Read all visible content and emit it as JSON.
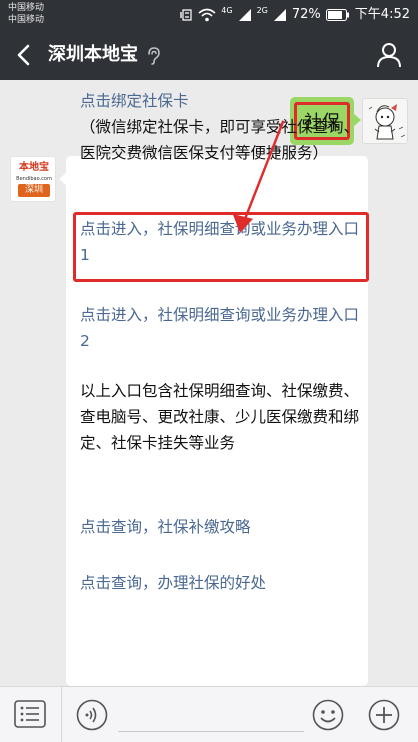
{
  "status_bar": {
    "carrier_1": "中国移动",
    "carrier_2": "中国移动",
    "network_label_1": "4G",
    "network_label_2": "2G",
    "battery": "72%",
    "time": "下午4:52"
  },
  "nav": {
    "title": "深圳本地宝",
    "back_icon": "chevron-left-icon",
    "ear_icon": "ear-icon",
    "profile_icon": "person-icon"
  },
  "chat": {
    "sent_message": "社保",
    "bot_logo": {
      "line1": "本地宝",
      "line2": "Bendibao.com",
      "line3": "深圳"
    },
    "messages": [
      {
        "text": "点击绑定社保卡",
        "link": true
      },
      {
        "text": "（微信绑定社保卡，即可享受社保查询、医院交费微信医保支付等便捷服务）",
        "link": false
      },
      {
        "text": "点击进入，社保明细查询或业务办理入口1",
        "link": true
      },
      {
        "text": "点击进入，社保明细查询或业务办理入口2",
        "link": true
      },
      {
        "text": "以上入口包含社保明细查询、社保缴费、查电脑号、更改社康、少儿医保缴费和绑定、社保卡挂失等业务",
        "link": false
      },
      {
        "text": "点击查询，社保补缴攻略",
        "link": true
      },
      {
        "text": "点击查询，办理社保的好处",
        "link": true
      }
    ],
    "highlight_color": "#e02b2b",
    "sent_bubble_color": "#9bd764",
    "link_color": "#4a6891"
  },
  "bottom_bar": {
    "menu_icon": "menu-list-icon",
    "voice_icon": "voice-icon",
    "emoji_icon": "smiley-icon",
    "plus_icon": "plus-icon"
  }
}
